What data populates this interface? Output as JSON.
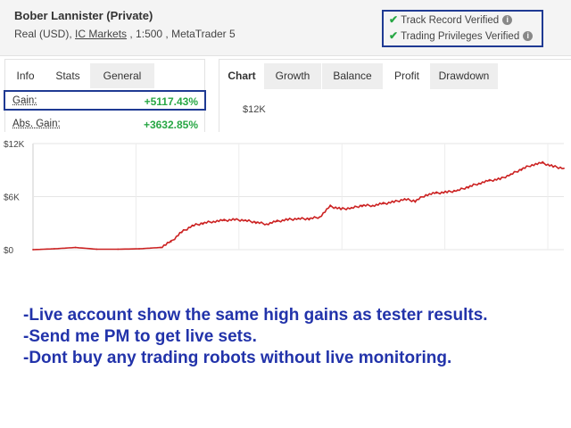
{
  "header": {
    "account_name": "Bober Lannister (Private)",
    "account_type": "Real (USD),",
    "broker": "IC Markets",
    "leverage_platform": ", 1:500 , MetaTrader 5",
    "verified": [
      {
        "label": "Track Record Verified"
      },
      {
        "label": "Trading Privileges Verified"
      }
    ],
    "check_color": "#28a745",
    "highlight_color": "#1f3a93"
  },
  "left_panel": {
    "tabs": [
      "Info",
      "Stats",
      "General"
    ],
    "rows": [
      {
        "label": "Gain:",
        "value": "+5117.43%"
      },
      {
        "label": "Abs. Gain:",
        "value": "+3632.85%"
      }
    ]
  },
  "right_panel": {
    "tabs": [
      "Chart",
      "Growth",
      "Balance",
      "Profit",
      "Drawdown"
    ],
    "active_tab": "Profit",
    "tick_top": "$12K"
  },
  "chart_data": {
    "type": "line",
    "y_ticks": [
      "$12K",
      "$6K",
      "$0"
    ],
    "ylim": [
      0,
      12000
    ],
    "grid": true,
    "line_color": "#cc2222",
    "series": [
      {
        "x": [
          0,
          4,
          8,
          12,
          16,
          20,
          24,
          26,
          28,
          30,
          32,
          34,
          36,
          38,
          40,
          42,
          44,
          46,
          48,
          50,
          52,
          54,
          56,
          58,
          60,
          62,
          64,
          66,
          68,
          70,
          72,
          74,
          76,
          78,
          80,
          82,
          84,
          86,
          88,
          90,
          92,
          94,
          96,
          98,
          100
        ],
        "values": [
          0,
          100,
          250,
          50,
          50,
          100,
          250,
          900,
          2000,
          2700,
          3000,
          3200,
          3300,
          3400,
          3300,
          3100,
          2900,
          3200,
          3400,
          3500,
          3500,
          3700,
          4900,
          4600,
          4700,
          5000,
          5000,
          5200,
          5400,
          5700,
          5500,
          6200,
          6400,
          6500,
          6700,
          7100,
          7500,
          7800,
          8000,
          8500,
          9100,
          9600,
          9800,
          9400,
          9200
        ]
      }
    ]
  },
  "messages": [
    "-Live account show the same high gains as tester results.",
    "-Send me PM to get live sets.",
    "-Dont buy any trading robots without live monitoring."
  ]
}
